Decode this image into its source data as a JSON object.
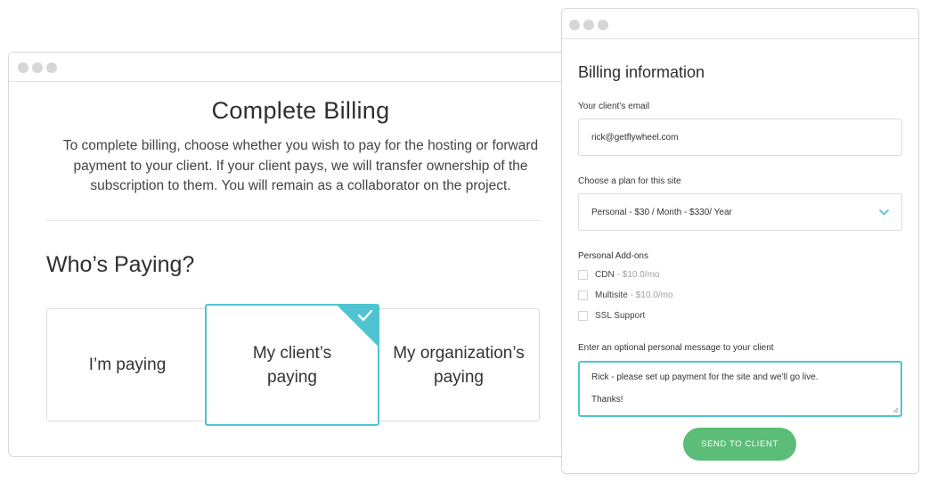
{
  "left_window": {
    "title": "Complete Billing",
    "description": "To complete billing, choose whether you wish to pay for the hosting or forward payment to your client. If your client pays, we will transfer ownership of the subscription to them. You will remain as a collaborator on the project.",
    "heading": "Who’s Paying?",
    "options": [
      {
        "label": "I’m paying"
      },
      {
        "label": "My client’s paying",
        "selected": true
      },
      {
        "label": "My organization’s paying"
      }
    ]
  },
  "right_window": {
    "title": "Billing information",
    "email_label": "Your client’s email",
    "email_value": "rick@getflywheel.com",
    "plan_label": "Choose a plan for this site",
    "plan_value": "Personal - $30 / Month - $330/ Year",
    "addons_label": "Personal Add-ons",
    "addons": [
      {
        "name": "CDN",
        "price": "- $10.0/mo",
        "checked": false
      },
      {
        "name": "Multisite",
        "price": "- $10.0/mo",
        "checked": false
      },
      {
        "name": "SSL Support",
        "price": "",
        "checked": false
      }
    ],
    "message_label": "Enter an optional personal message to your client",
    "message_line1": "Rick - please set up payment for the site and we’ll go live.",
    "message_line2": "Thanks!",
    "send_label": "SEND TO CLIENT"
  },
  "colors": {
    "accent": "#4fc3d1",
    "button": "#5cbd78",
    "window_dot": "#d6d6d6"
  },
  "icons": [
    "window-dot-icon",
    "checkmark-icon",
    "chevron-down-icon",
    "resize-handle-icon"
  ]
}
